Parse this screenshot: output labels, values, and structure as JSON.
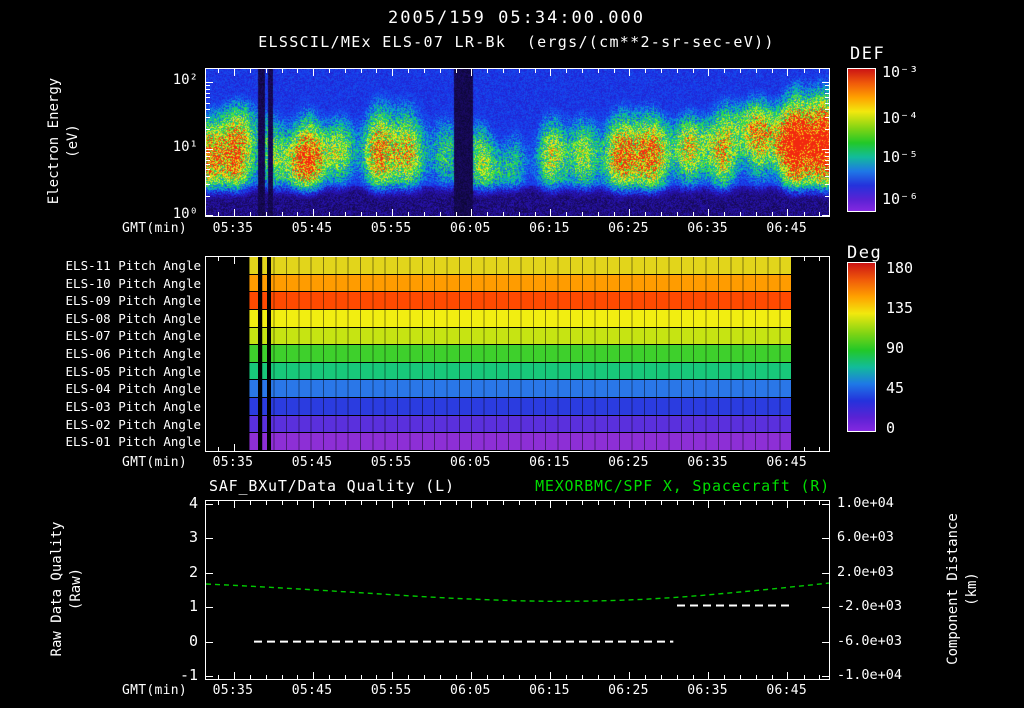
{
  "header": {
    "timestamp_title": "2005/159 05:34:00.000",
    "plot_title": "ELSSCIL/MEx ELS-07 LR-Bk  (ergs/(cm**2-sr-sec-eV))"
  },
  "chart_data": [
    {
      "type": "heatmap",
      "name": "electron-energy-spectrogram",
      "title": "ELSSCIL/MEx ELS-07 LR-Bk",
      "units_label": "ergs/(cm**2-sr-sec-eV)",
      "xlabel": "GMT(min)",
      "x_ticks": [
        "05:35",
        "05:45",
        "05:55",
        "06:05",
        "06:15",
        "06:25",
        "06:35",
        "06:45"
      ],
      "ylabel_lines": [
        "Electron Energy",
        "(eV)"
      ],
      "y_scale": "log",
      "y_ticks": [
        "10²",
        "10¹",
        "10⁰"
      ],
      "y_range_ev": [
        1,
        158
      ],
      "colorbar": {
        "title": "DEF",
        "tick_labels": [
          "10⁻³",
          "10⁻⁴",
          "10⁻⁵",
          "10⁻⁶"
        ],
        "tick_fracs": [
          0.028,
          0.352,
          0.627,
          0.922
        ],
        "range": [
          "1e-3",
          "1e-6"
        ]
      },
      "band": {
        "center_log10_ev": 0.88,
        "sigma_log10": 0.4
      },
      "dropouts_t": [
        [
          0.082,
          0.094
        ],
        [
          0.099,
          0.107
        ],
        [
          0.397,
          0.428
        ]
      ],
      "hotspots": [
        {
          "t": 0.06,
          "log10_ev": 1.45,
          "amp": 0.28
        },
        {
          "t": 0.16,
          "log10_ev": 0.75,
          "amp": 0.4
        },
        {
          "t": 0.2,
          "log10_ev": 1.05,
          "amp": 0.3
        },
        {
          "t": 0.47,
          "log10_ev": 0.65,
          "amp": 0.3
        },
        {
          "t": 0.78,
          "log10_ev": 1.15,
          "amp": 0.3
        },
        {
          "t": 0.88,
          "log10_ev": 1.35,
          "amp": 0.5
        },
        {
          "t": 0.93,
          "log10_ev": 1.1,
          "amp": 0.35
        },
        {
          "t": 0.985,
          "log10_ev": 1.3,
          "amp": 0.3
        }
      ]
    },
    {
      "type": "heatmap",
      "name": "pitch-angle-panel",
      "xlabel": "GMT(min)",
      "x_ticks": [
        "05:35",
        "05:45",
        "05:55",
        "06:05",
        "06:15",
        "06:25",
        "06:35",
        "06:45"
      ],
      "rows": [
        {
          "label": "ELS-11 Pitch Angle",
          "pitch_deg": 120,
          "color": "#e2d51b"
        },
        {
          "label": "ELS-10 Pitch Angle",
          "pitch_deg": 149,
          "color": "#ff9c00"
        },
        {
          "label": "ELS-09 Pitch Angle",
          "pitch_deg": 163,
          "color": "#ff4a00"
        },
        {
          "label": "ELS-08 Pitch Angle",
          "pitch_deg": 117,
          "color": "#f2ee11"
        },
        {
          "label": "ELS-07 Pitch Angle",
          "pitch_deg": 107,
          "color": "#c6e412"
        },
        {
          "label": "ELS-06 Pitch Angle",
          "pitch_deg": 92,
          "color": "#3ed02c"
        },
        {
          "label": "ELS-05 Pitch Angle",
          "pitch_deg": 76,
          "color": "#18c87a"
        },
        {
          "label": "ELS-04 Pitch Angle",
          "pitch_deg": 48,
          "color": "#2a77e8"
        },
        {
          "label": "ELS-03 Pitch Angle",
          "pitch_deg": 34,
          "color": "#2b3ce0"
        },
        {
          "label": "ELS-02 Pitch Angle",
          "pitch_deg": 20,
          "color": "#5a30dd"
        },
        {
          "label": "ELS-01 Pitch Angle",
          "pitch_deg": 8,
          "color": "#8d2fd6"
        }
      ],
      "data_extent_t": [
        0.069,
        0.939
      ],
      "dropouts_t": [
        [
          0.0835,
          0.0899
        ],
        [
          0.0979,
          0.1043
        ]
      ],
      "cell_width_frac": 0.0198,
      "colorbar": {
        "title": "Deg",
        "tick_labels": [
          "180",
          "135",
          "90",
          "45",
          "0"
        ],
        "tick_fracs": [
          0.036,
          0.274,
          0.512,
          0.75,
          0.988
        ],
        "range": [
          180,
          0
        ]
      }
    },
    {
      "type": "line",
      "name": "quality-and-distance",
      "title_left": "SAF_BXuT/Data Quality (L)",
      "title_right": "MEXORBMC/SPF X, Spacecraft (R)",
      "title_right_color": "#00dc00",
      "xlabel": "GMT(min)",
      "x_ticks": [
        "05:35",
        "05:45",
        "05:55",
        "06:05",
        "06:15",
        "06:25",
        "06:35",
        "06:45"
      ],
      "left_axis": {
        "label_lines": [
          "Raw Data Quality",
          "(Raw)"
        ],
        "ticks": [
          "4",
          "3",
          "2",
          "1",
          "0",
          "-1"
        ],
        "range": [
          -1,
          4
        ]
      },
      "right_axis": {
        "label_lines": [
          "Component Distance",
          "(km)"
        ],
        "ticks": [
          "1.0e+04",
          "6.0e+03",
          "2.0e+03",
          "-2.0e+03",
          "-6.0e+03",
          "-1.0e+04"
        ],
        "range": [
          -10000,
          10000
        ]
      },
      "series": [
        {
          "name": "MEXORBMC/SPF X Spacecraft distance",
          "axis": "right",
          "color": "#00c800",
          "style": "dashed",
          "t": [
            0,
            0.05,
            0.1,
            0.15,
            0.2,
            0.25,
            0.3,
            0.35,
            0.4,
            0.45,
            0.5,
            0.55,
            0.6,
            0.65,
            0.7,
            0.75,
            0.8,
            0.85,
            0.9,
            0.95,
            1.0
          ],
          "km": [
            700,
            520,
            330,
            120,
            -100,
            -330,
            -560,
            -780,
            -980,
            -1130,
            -1250,
            -1310,
            -1300,
            -1230,
            -1090,
            -880,
            -600,
            -280,
            60,
            430,
            800
          ]
        },
        {
          "name": "SAF_BXuT Data Quality",
          "axis": "left",
          "color": "#ffffff",
          "style": "dashed",
          "segments": [
            {
              "t0": 0.077,
              "t1": 0.75,
              "value": 0
            },
            {
              "t0": 0.756,
              "t1": 0.939,
              "value": 1.05
            }
          ]
        }
      ]
    }
  ]
}
